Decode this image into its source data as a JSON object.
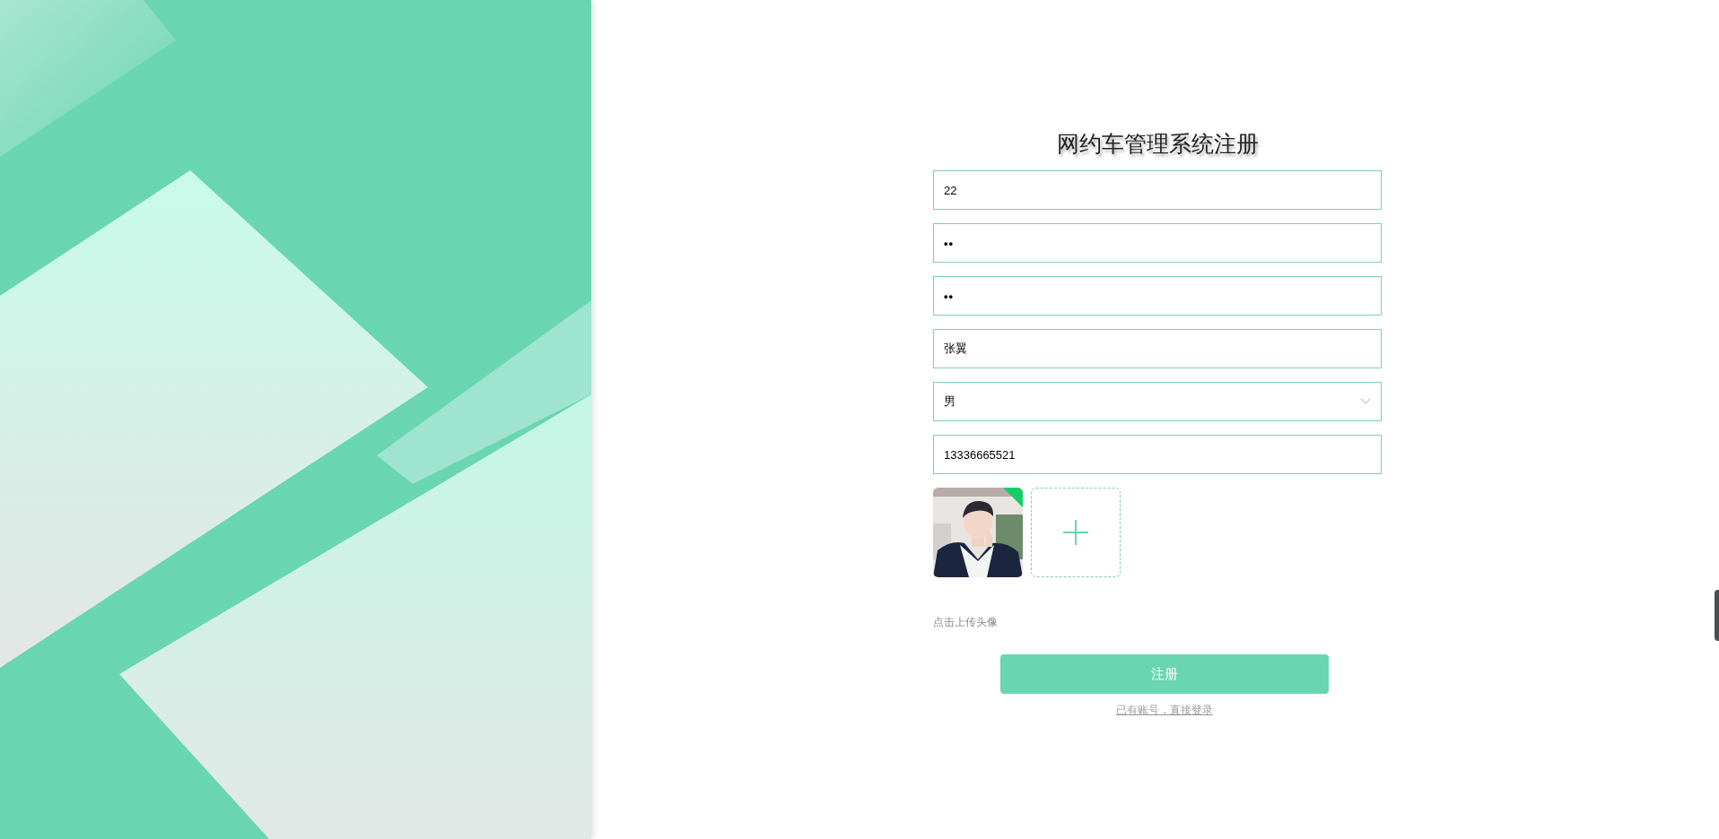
{
  "title": "网约车管理系统注册",
  "fields": [
    {
      "kind": "text",
      "value": "22"
    },
    {
      "kind": "password",
      "value": "••"
    },
    {
      "kind": "password",
      "value": "••"
    },
    {
      "kind": "text",
      "value": "张翼"
    },
    {
      "kind": "select",
      "value": "男"
    },
    {
      "kind": "text",
      "value": "13336665521"
    }
  ],
  "upload": {
    "hint": "点击上传头像"
  },
  "submit": "注册",
  "login_link": "已有账号，直接登录"
}
